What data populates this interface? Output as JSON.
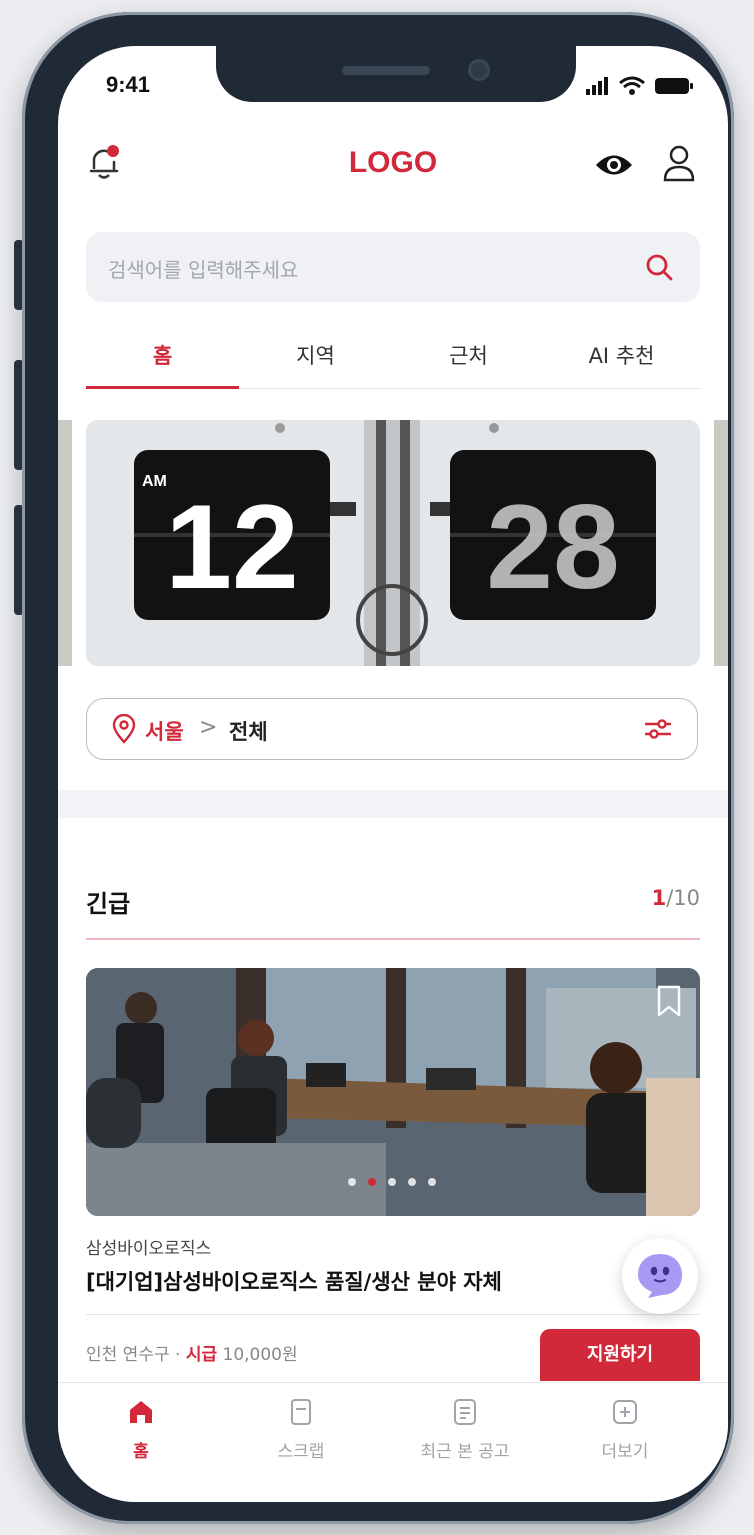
{
  "status_bar": {
    "time": "9:41"
  },
  "header": {
    "logo": "LOGO"
  },
  "search": {
    "placeholder": "검색어를 입력해주세요"
  },
  "tabs": [
    {
      "label": "홈",
      "active": true
    },
    {
      "label": "지역",
      "active": false
    },
    {
      "label": "근처",
      "active": false
    },
    {
      "label": "AI 추천",
      "active": false
    }
  ],
  "banner": {
    "clock_left": "12",
    "clock_right": "28",
    "clock_tag": "AM"
  },
  "location": {
    "city": "서울",
    "separator": ">",
    "area": "전체"
  },
  "urgent": {
    "title": "긴급",
    "pager_current": "1",
    "pager_total": "/10",
    "card": {
      "company": "삼성바이오로직스",
      "title": "[대기업]삼성바이오로직스 품질/생산 분야 자체",
      "location": "인천 연수구",
      "meta_sep": " · ",
      "wage_label": "시급",
      "wage": "10,000원",
      "apply_label": "지원하기"
    }
  },
  "bottom_nav": [
    {
      "label": "홈",
      "icon": "home-icon",
      "active": true
    },
    {
      "label": "스크랩",
      "icon": "bookmark-icon",
      "active": false
    },
    {
      "label": "최근 본 공고",
      "icon": "document-icon",
      "active": false
    },
    {
      "label": "더보기",
      "icon": "plus-square-icon",
      "active": false
    }
  ],
  "colors": {
    "accent": "#d1283a",
    "frame": "#1f2a36"
  }
}
